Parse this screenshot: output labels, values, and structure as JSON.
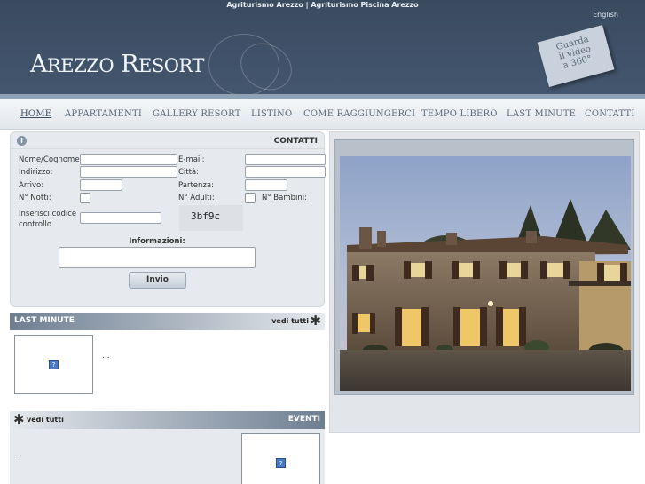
{
  "header": {
    "topline": "Agriturismo Arezzo | Agriturismo Piscina Arezzo",
    "language": "English",
    "logo": {
      "big_a": "A",
      "rest_1": "REZZO",
      "big_r": "R",
      "rest_2": "ESORT"
    },
    "video_sticker": [
      "Guarda",
      "il video",
      "a 360°"
    ]
  },
  "nav": [
    "HOME",
    "APPARTAMENTI",
    "GALLERY RESORT",
    "LISTINO",
    "COME RAGGIUNGERCI",
    "TEMPO LIBERO",
    "LAST MINUTE",
    "CONTATTI"
  ],
  "contact": {
    "info_icon": "i",
    "title": "CONTATTI",
    "labels": {
      "name": "Nome/Cognome:",
      "email": "E-mail:",
      "address": "Indirizzo:",
      "city": "Città:",
      "arrival": "Arrivo:",
      "departure": "Partenza:",
      "nights": "N° Notti:",
      "adults": "N° Adulti:",
      "children": "N° Bambini:",
      "code_1": "Inserisci codice",
      "code_2": "controllo",
      "info": "Informazioni:"
    },
    "captcha": "3bf9c",
    "send": "Invio"
  },
  "last_minute": {
    "title": "LAST MINUTE",
    "view_all": "vedi tutti",
    "image_icon": "?",
    "text": "..."
  },
  "events": {
    "title": "EVENTI",
    "view_all": "vedi tutti",
    "image_icon": "?",
    "text": "..."
  },
  "colors": {
    "header": "#40526a",
    "accent": "#7f93a9",
    "panel": "#e6eaee"
  },
  "icons": [
    "info-icon",
    "asterisk-icon",
    "broken-image-icon"
  ]
}
